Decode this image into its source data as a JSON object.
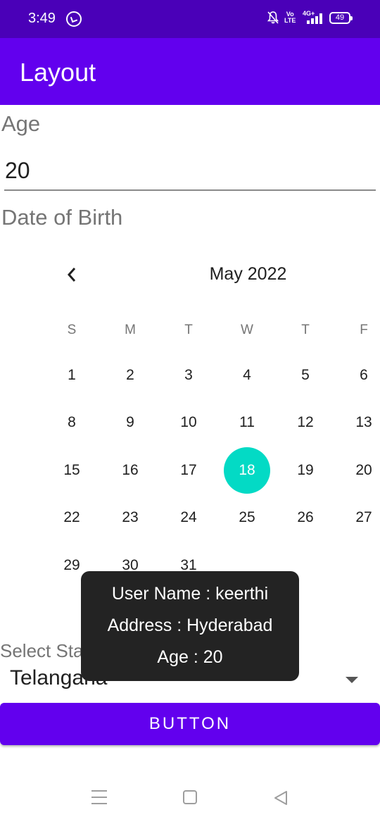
{
  "status_bar": {
    "time": "3:49",
    "network": "4G+",
    "volte": [
      "Vo",
      "LTE"
    ],
    "battery": "49"
  },
  "app_bar": {
    "title": "Layout"
  },
  "form": {
    "age_label": "Age",
    "age_value": "20",
    "dob_label": "Date of Birth"
  },
  "calendar": {
    "month_label": "May 2022",
    "weekdays": [
      "S",
      "M",
      "T",
      "W",
      "T",
      "F"
    ],
    "weeks": [
      [
        "1",
        "2",
        "3",
        "4",
        "5",
        "6"
      ],
      [
        "8",
        "9",
        "10",
        "11",
        "12",
        "13"
      ],
      [
        "15",
        "16",
        "17",
        "18",
        "19",
        "20"
      ],
      [
        "22",
        "23",
        "24",
        "25",
        "26",
        "27"
      ],
      [
        "29",
        "30",
        "31",
        "",
        "",
        ""
      ]
    ],
    "selected_day": "18",
    "selected_color": "#03dac5"
  },
  "state": {
    "label": "Select State",
    "value": "Telangana"
  },
  "toast": {
    "lines": [
      "User Name : keerthi",
      "Address : Hyderabad",
      "Age : 20"
    ]
  },
  "button": {
    "label": "BUTTON"
  },
  "colors": {
    "status_bar": "#4a00b8",
    "primary": "#6200ee",
    "accent": "#03dac5",
    "toast_bg": "#232323"
  }
}
